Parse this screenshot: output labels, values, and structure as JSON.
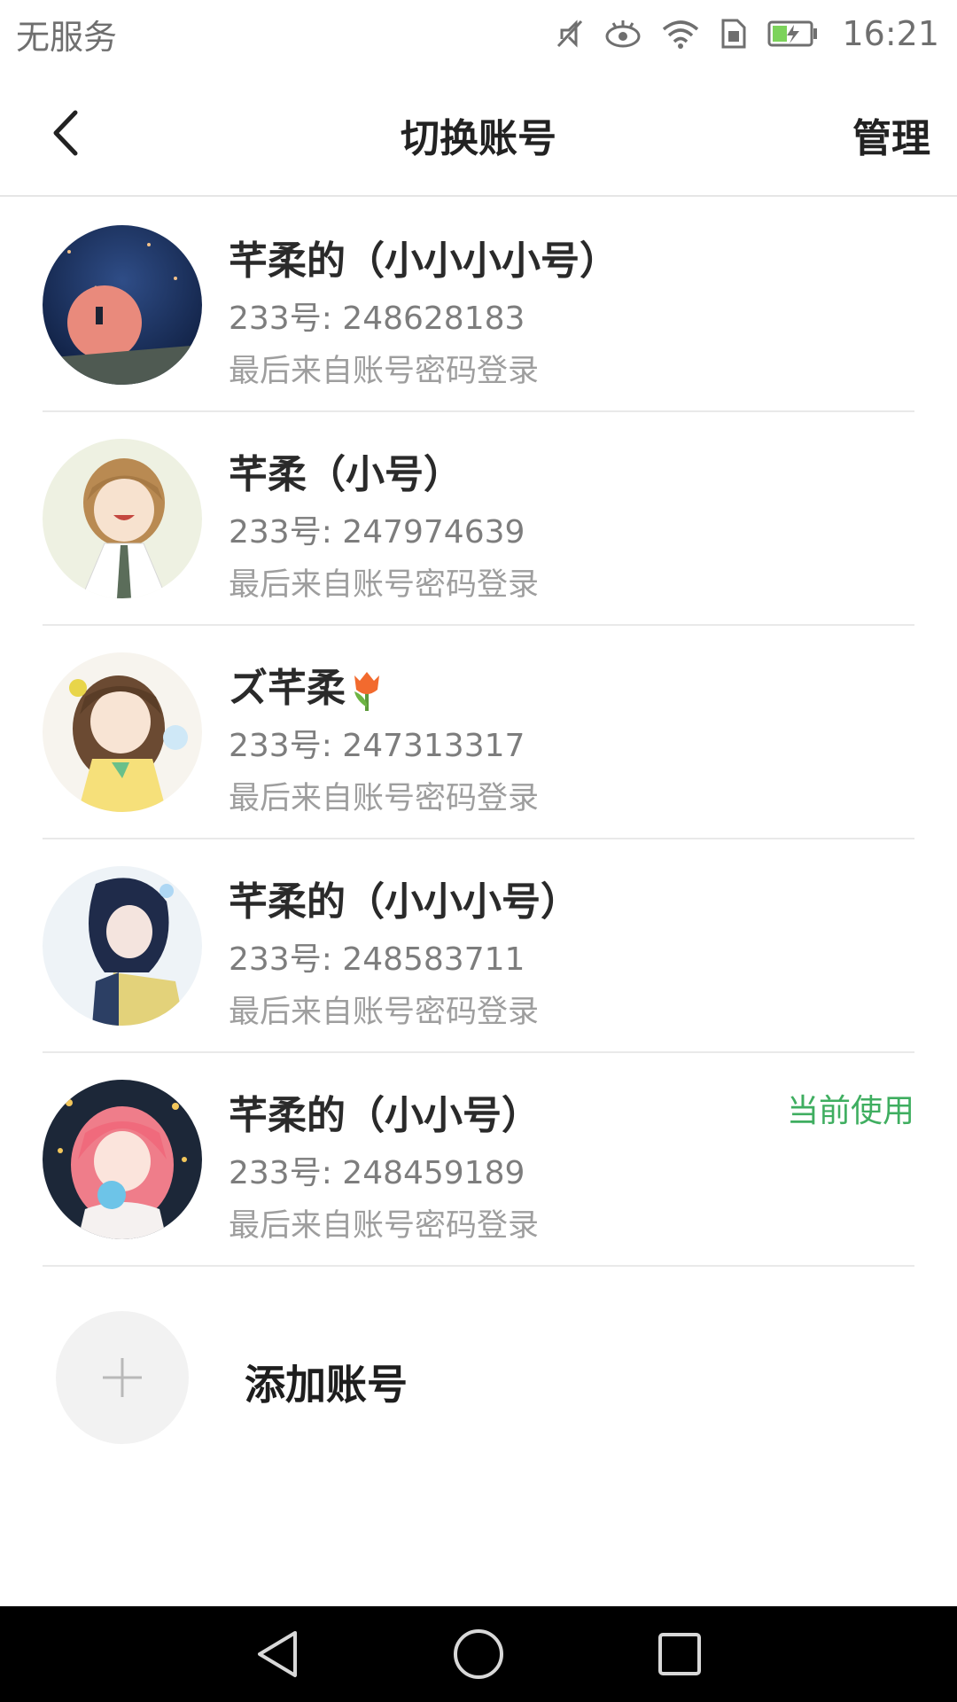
{
  "status_bar": {
    "carrier": "无服务",
    "time": "16:21",
    "icons": [
      "mute-icon",
      "eye-comfort-icon",
      "wifi-icon",
      "sim-icon",
      "battery-charging-icon"
    ]
  },
  "header": {
    "title": "切换账号",
    "manage_label": "管理",
    "back_icon": "chevron-left-icon"
  },
  "accounts": [
    {
      "name": "芊柔的（小小小小号）",
      "uid": "233号: 248628183",
      "login_source": "最后来自账号密码登录",
      "current": false
    },
    {
      "name": "芊柔（小号）",
      "uid": "233号: 247974639",
      "login_source": "最后来自账号密码登录",
      "current": false
    },
    {
      "name": "ズ芊柔",
      "uid": "233号: 247313317",
      "login_source": "最后来自账号密码登录",
      "current": false,
      "name_emoji": "tulip-icon"
    },
    {
      "name": "芊柔的（小小小号）",
      "uid": "233号: 248583711",
      "login_source": "最后来自账号密码登录",
      "current": false
    },
    {
      "name": "芊柔的（小小号）",
      "uid": "233号: 248459189",
      "login_source": "最后来自账号密码登录",
      "current": true,
      "current_label": "当前使用"
    }
  ],
  "add_account": {
    "label": "添加账号",
    "icon": "plus-icon"
  },
  "nav_bar": {
    "icons": [
      "back-triangle-icon",
      "home-circle-icon",
      "recents-square-icon"
    ]
  },
  "colors": {
    "accent_green": "#3fae60",
    "divider": "#e9e9e9",
    "nav_background": "#000000"
  }
}
